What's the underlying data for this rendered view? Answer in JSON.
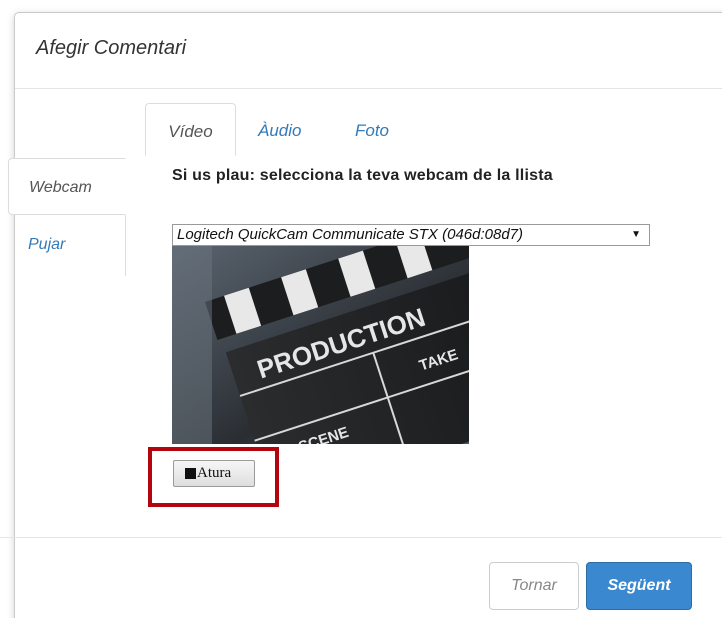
{
  "modal": {
    "title": "Afegir Comentari"
  },
  "side_tabs": [
    {
      "label": "Webcam",
      "active": true
    },
    {
      "label": "Pujar",
      "active": false
    }
  ],
  "media_tabs": [
    {
      "label": "Vídeo",
      "active": true
    },
    {
      "label": "Àudio",
      "active": false
    },
    {
      "label": "Foto",
      "active": false
    }
  ],
  "webcam": {
    "prompt": "Si us plau: selecciona la teva webcam de la llista",
    "selected_device": "Logitech QuickCam Communicate STX (046d:08d7)",
    "stop_label": "Atura",
    "preview_text": {
      "line1": "PRODUCTION",
      "line2": "SCENE",
      "line3": "TAKE"
    }
  },
  "footer": {
    "back_label": "Tornar",
    "next_label": "Següent"
  },
  "colors": {
    "link": "#337ab7",
    "primary": "#3a88cf",
    "highlight": "#b2050d"
  }
}
